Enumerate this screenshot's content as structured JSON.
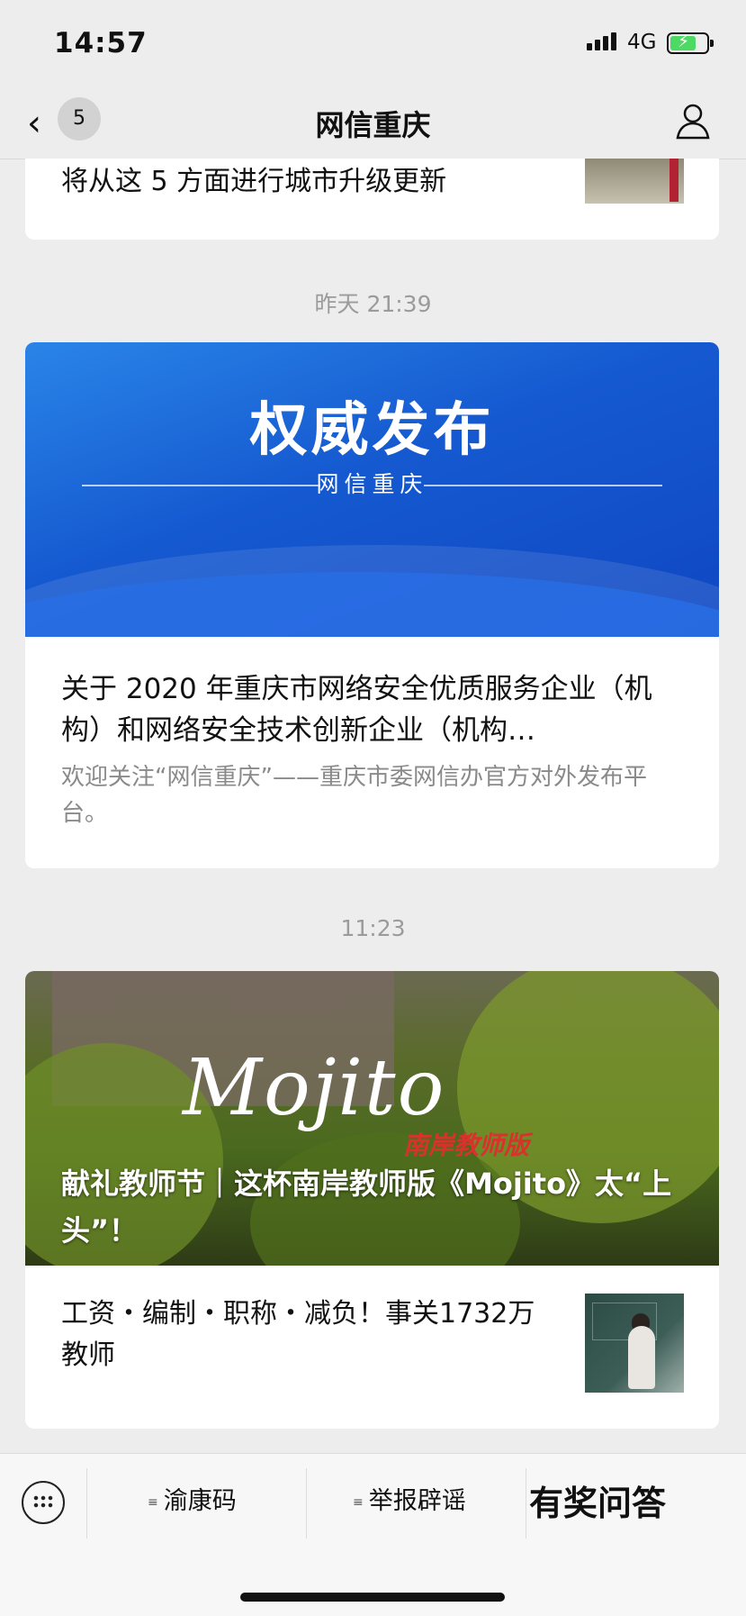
{
  "status_bar": {
    "time": "14:57",
    "network": "4G"
  },
  "nav": {
    "badge_count": "5",
    "title": "网信重庆"
  },
  "articles": {
    "partial": {
      "title": "将从这 5 方面进行城市升级更新"
    },
    "timestamp1": "昨天 21:39",
    "card2": {
      "banner_title": "权威发布",
      "banner_subtitle": "网信重庆",
      "headline": "关于 2020 年重庆市网络安全优质服务企业（机构）和网络安全技术创新企业（机构…",
      "description": "欢迎关注“网信重庆”——重庆市委网信办官方对外发布平台。"
    },
    "timestamp2": "11:23",
    "card3": {
      "image_text": "Mojito",
      "image_subtext": "南岸教师版",
      "overlay_title": "献礼教师节｜这杯南岸教师版《Mojito》太“上头”！",
      "sub_title": "工资・编制・职称・减负！事关1732万教师"
    }
  },
  "bottom_menu": {
    "item1": "渝康码",
    "item2": "举报辟谣",
    "item3": "有奖问答"
  }
}
